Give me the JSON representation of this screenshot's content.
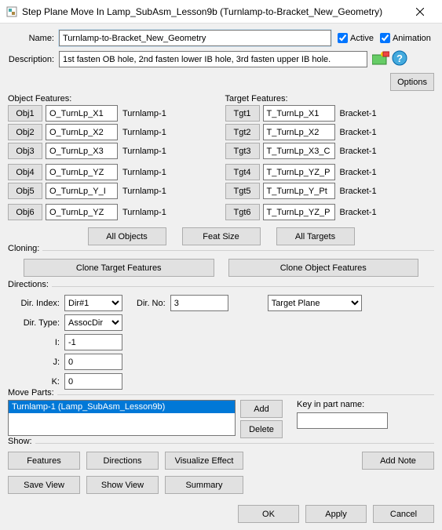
{
  "titlebar": {
    "text": "Step Plane Move In Lamp_SubAsm_Lesson9b (Turnlamp-to-Bracket_New_Geometry)"
  },
  "name_label": "Name:",
  "name_value": "Turnlamp-to-Bracket_New_Geometry",
  "active_label": "Active",
  "animation_label": "Animation",
  "desc_label": "Description:",
  "desc_value": "1st fasten OB hole, 2nd fasten lower IB hole, 3rd fasten upper IB hole.",
  "options_label": "Options",
  "object_features_label": "Object Features:",
  "target_features_label": "Target Features:",
  "obj_rows": [
    {
      "btn": "Obj1",
      "val": "O_TurnLp_X1",
      "suf": "Turnlamp-1"
    },
    {
      "btn": "Obj2",
      "val": "O_TurnLp_X2",
      "suf": "Turnlamp-1"
    },
    {
      "btn": "Obj3",
      "val": "O_TurnLp_X3",
      "suf": "Turnlamp-1"
    },
    {
      "btn": "Obj4",
      "val": "O_TurnLp_YZ",
      "suf": "Turnlamp-1"
    },
    {
      "btn": "Obj5",
      "val": "O_TurnLp_Y_I",
      "suf": "Turnlamp-1"
    },
    {
      "btn": "Obj6",
      "val": "O_TurnLp_YZ",
      "suf": "Turnlamp-1"
    }
  ],
  "tgt_rows": [
    {
      "btn": "Tgt1",
      "val": "T_TurnLp_X1",
      "suf": "Bracket-1"
    },
    {
      "btn": "Tgt2",
      "val": "T_TurnLp_X2",
      "suf": "Bracket-1"
    },
    {
      "btn": "Tgt3",
      "val": "T_TurnLp_X3_C",
      "suf": "Bracket-1"
    },
    {
      "btn": "Tgt4",
      "val": "T_TurnLp_YZ_P",
      "suf": "Bracket-1"
    },
    {
      "btn": "Tgt5",
      "val": "T_TurnLp_Y_Pt",
      "suf": "Bracket-1"
    },
    {
      "btn": "Tgt6",
      "val": "T_TurnLp_YZ_P",
      "suf": "Bracket-1"
    }
  ],
  "all_objects": "All Objects",
  "feat_size": "Feat Size",
  "all_targets": "All Targets",
  "cloning_label": "Cloning:",
  "clone_target": "Clone Target Features",
  "clone_object": "Clone Object Features",
  "directions_label": "Directions:",
  "dir_index_label": "Dir. Index:",
  "dir_index_val": "Dir#1",
  "dir_no_label": "Dir. No:",
  "dir_no_val": "3",
  "target_plane": "Target Plane",
  "dir_type_label": "Dir. Type:",
  "dir_type_val": "AssocDir",
  "i_label": "I:",
  "i_val": "-1",
  "j_label": "J:",
  "j_val": "0",
  "k_label": "K:",
  "k_val": "0",
  "move_parts_label": "Move Parts:",
  "move_item": "Turnlamp-1 (Lamp_SubAsm_Lesson9b)",
  "add": "Add",
  "delete": "Delete",
  "keyin_label": "Key in part name:",
  "keyin_val": "",
  "show_label": "Show:",
  "features": "Features",
  "directions": "Directions",
  "visualize": "Visualize Effect",
  "add_note": "Add Note",
  "save_view": "Save View",
  "show_view": "Show View",
  "summary": "Summary",
  "ok": "OK",
  "apply": "Apply",
  "cancel": "Cancel"
}
